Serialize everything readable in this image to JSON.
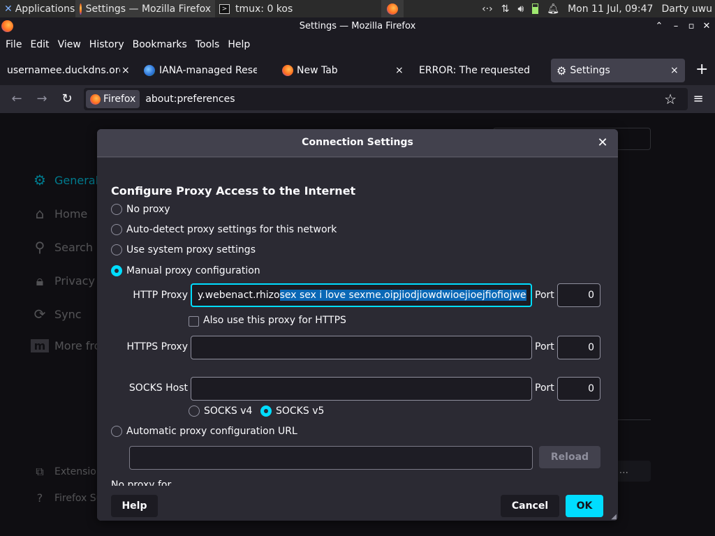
{
  "panel": {
    "tasks": [
      {
        "label": "Applications",
        "icon": "xfce-icon"
      },
      {
        "label": "Settings — Mozilla Firefox",
        "icon": "firefox-icon"
      },
      {
        "label": "tmux: 0 kos",
        "icon": "terminal-icon"
      },
      {
        "label": "",
        "icon": "firefox-icon"
      }
    ],
    "clock": "Mon 11 Jul, 09:47",
    "user": "Darty uwu"
  },
  "window": {
    "title": "Settings — Mozilla Firefox"
  },
  "menu": [
    "File",
    "Edit",
    "View",
    "History",
    "Bookmarks",
    "Tools",
    "Help"
  ],
  "tabs": [
    {
      "label": "usernamee.duckdns.org",
      "close": "×"
    },
    {
      "label": "IANA-managed Reserved",
      "close": ""
    },
    {
      "label": "New Tab",
      "close": "×"
    },
    {
      "label": "ERROR: The requested URL",
      "close": ""
    },
    {
      "label": "Settings",
      "close": "×",
      "selected": true
    }
  ],
  "navbar": {
    "identity_label": "Firefox",
    "url": "about:preferences"
  },
  "background_page": {
    "categories": [
      "General",
      "Home",
      "Search",
      "Privacy",
      "Sync",
      "More fro"
    ],
    "footer_links": [
      "Extension",
      "Firefox Su"
    ],
    "ellipsis": "..."
  },
  "dialog": {
    "title": "Connection Settings",
    "section_title": "Configure Proxy Access to the Internet",
    "options": {
      "no_proxy": "No proxy",
      "auto_detect": "Auto-detect proxy settings for this network",
      "system": "Use system proxy settings",
      "manual": "Manual proxy configuration",
      "auto_url": "Automatic proxy configuration URL"
    },
    "selected_option": "manual",
    "http_proxy": {
      "label": "HTTP Proxy",
      "value_plain": "y.webenact.rhizo",
      "value_selected": "sex sex i love sexme.oipjiodjiowdwioejioejfiofiojwe",
      "port_label": "Port",
      "port": "0"
    },
    "also_https": {
      "label": "Also use this proxy for HTTPS",
      "checked": false
    },
    "https_proxy": {
      "label": "HTTPS Proxy",
      "value": "",
      "port_label": "Port",
      "port": "0"
    },
    "socks_host": {
      "label": "SOCKS Host",
      "value": "",
      "port_label": "Port",
      "port": "0"
    },
    "socks_versions": {
      "v4": "SOCKS v4",
      "v5": "SOCKS v5",
      "selected": "v5"
    },
    "auto_url_value": "",
    "reload_label": "Reload",
    "no_proxy_for_label": "No proxy for",
    "buttons": {
      "help": "Help",
      "cancel": "Cancel",
      "ok": "OK"
    }
  },
  "colors": {
    "accent": "#00ddff",
    "selection": "#0a68b6",
    "dialog_bg": "#42414d",
    "page_bg": "#1c1b22"
  }
}
